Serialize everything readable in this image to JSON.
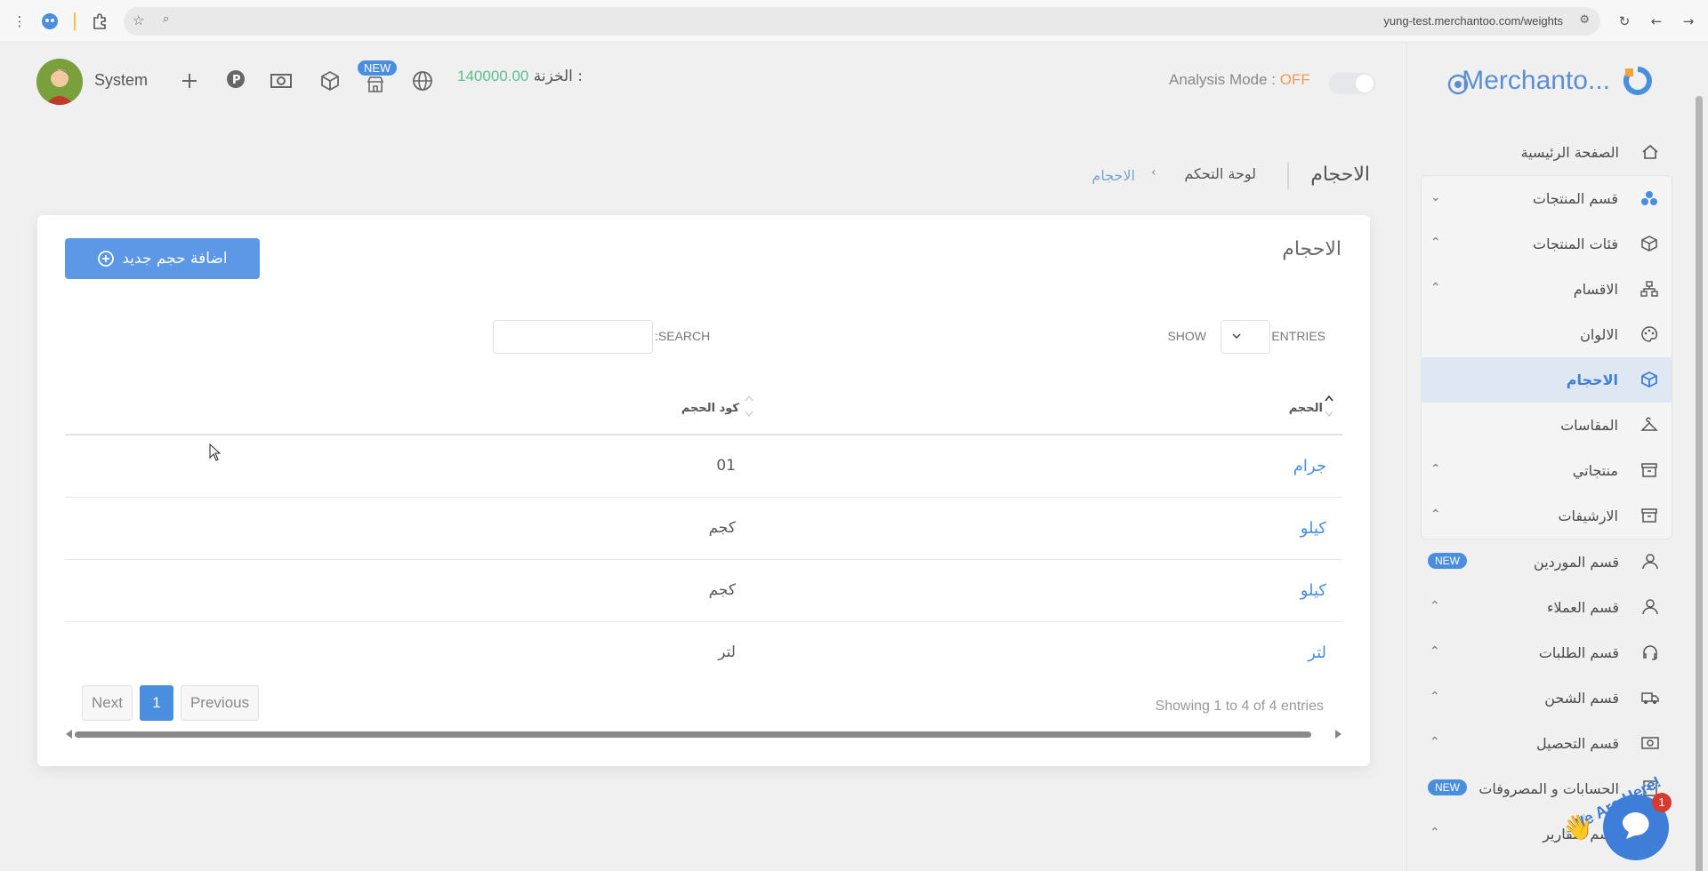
{
  "browser": {
    "url": "yung-test.merchantoo.com/weights"
  },
  "brand": {
    "name": "Merchanto...",
    "accent": "#5b8fd4"
  },
  "topbar": {
    "user": "System",
    "new_badge": "NEW",
    "treasury_label": "الخزنة : ",
    "treasury_amount": "140000.00",
    "analysis_label": "Analysis Mode : ",
    "analysis_value": "OFF"
  },
  "breadcrumb": {
    "title": "الاحجام",
    "home": "لوحة التحكم",
    "current": "الاحجام"
  },
  "card": {
    "title": "الاحجام",
    "add_button": "اضافة حجم جديد",
    "show": "SHOW",
    "entries": "ENTRIES",
    "search": ":SEARCH",
    "columns": [
      "الحجم",
      "كود الحجم"
    ],
    "rows": [
      {
        "name": "جرام",
        "code": "01"
      },
      {
        "name": "كيلو",
        "code": "كجم"
      },
      {
        "name": "كيلو",
        "code": "كجم"
      },
      {
        "name": "لتر",
        "code": "لتر"
      }
    ],
    "showing": "Showing 1 to 4 of 4 entries",
    "pager": {
      "next": "Next",
      "page": "1",
      "previous": "Previous"
    }
  },
  "sidebar": {
    "items": [
      {
        "label": "الصفحة الرئيسية",
        "icon": "home-icon"
      },
      {
        "label": "قسم المنتجات",
        "icon": "products-icon"
      },
      {
        "label": "فئات المنتجات",
        "icon": "box-icon"
      },
      {
        "label": "الاقسام",
        "icon": "sitemap-icon"
      },
      {
        "label": "الالوان",
        "icon": "palette-icon"
      },
      {
        "label": "الاحجام",
        "icon": "cube-icon"
      },
      {
        "label": "المقاسات",
        "icon": "hanger-icon"
      },
      {
        "label": "منتجاتي",
        "icon": "archive-icon"
      },
      {
        "label": "الارشيفات",
        "icon": "archive-icon"
      },
      {
        "label": "قسم الموردين",
        "icon": "user-icon"
      },
      {
        "label": "قسم العملاء",
        "icon": "user-icon"
      },
      {
        "label": "قسم الطلبات",
        "icon": "headset-icon"
      },
      {
        "label": "قسم الشحن",
        "icon": "truck-icon"
      },
      {
        "label": "قسم التحصيل",
        "icon": "money-icon"
      },
      {
        "label": "الحسابات و المصروفات",
        "icon": "ledger-icon"
      },
      {
        "label": "قسم التقارير",
        "icon": "report-icon"
      }
    ],
    "new_badge": "NEW"
  },
  "chat": {
    "text": "We Are Here!",
    "badge": "1"
  }
}
